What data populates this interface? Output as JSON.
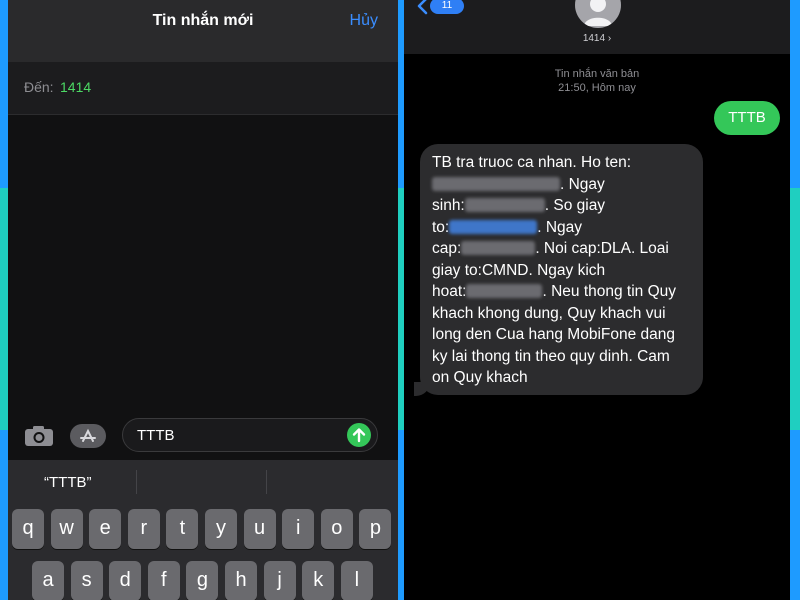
{
  "left_screen": {
    "header": {
      "title": "Tin nhắn mới",
      "cancel_label": "Hủy"
    },
    "recipient": {
      "label": "Đến:",
      "value": "1414"
    },
    "compose": {
      "value": "TTTB"
    },
    "keyboard": {
      "suggestion": "“TTTB”",
      "row1": [
        "q",
        "w",
        "e",
        "r",
        "t",
        "y",
        "u",
        "i",
        "o",
        "p"
      ],
      "row2": [
        "a",
        "s",
        "d",
        "f",
        "g",
        "h",
        "j",
        "k",
        "l"
      ]
    }
  },
  "right_screen": {
    "header": {
      "back_badge": "11",
      "contact": "1414 ›"
    },
    "meta": {
      "type": "Tin nhắn văn bản",
      "time": "21:50, Hôm nay"
    },
    "sent_message": "TTTB",
    "received_message": {
      "line1": "TB tra truoc ca nhan. Ho ten:",
      "seg_ngay": ". Ngay",
      "seg_sinh": "sinh:",
      "seg_sogiay": ". So giay",
      "seg_to": "to:",
      "seg_ngay2": ". Ngay",
      "seg_cap": "cap:",
      "seg_noicap": ". Noi cap:DLA. Loai",
      "line_giay": "giay to:CMND. Ngay kich",
      "seg_hoat": "hoat:",
      "seg_rest": ". Neu thong tin Quy khach khong dung, Quy khach vui long den Cua hang MobiFone dang ky lai thong tin theo quy dinh. Cam on Quy khach"
    }
  },
  "colors": {
    "ios_blue": "#3a8dff",
    "ios_green": "#34c759",
    "bubble_gray": "#2c2c2e"
  }
}
